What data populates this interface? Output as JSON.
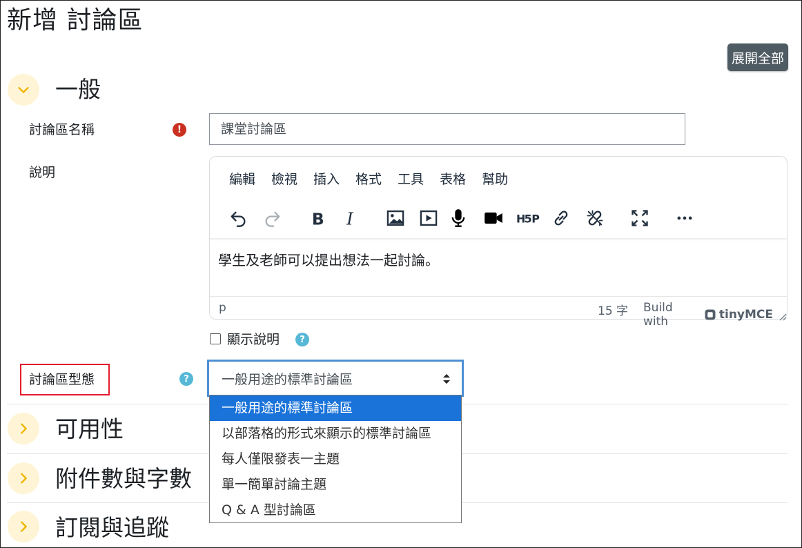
{
  "page_title": "新增 討論區",
  "expand_all_label": "展開全部",
  "sections": {
    "general": "一般",
    "availability": "可用性",
    "attachments": "附件數與字數",
    "subscription": "訂閱與追蹤"
  },
  "fields": {
    "name_label": "討論區名稱",
    "name_value": "課堂討論區",
    "description_label": "說明",
    "show_description_label": "顯示說明",
    "type_label": "討論區型態",
    "type_value": "一般用途的標準討論區"
  },
  "editor": {
    "menu": [
      "編輯",
      "檢視",
      "插入",
      "格式",
      "工具",
      "表格",
      "幫助"
    ],
    "toolbar_icons": [
      "undo-icon",
      "redo-icon",
      "bold-icon",
      "italic-icon",
      "image-icon",
      "media-icon",
      "microphone-icon",
      "video-camera-icon",
      "h5p-icon",
      "link-icon",
      "unlink-icon",
      "fullscreen-icon",
      "more-icon"
    ],
    "content": "學生及老師可以提出想法一起討論。",
    "status_path": "p",
    "word_count": "15 字",
    "build_with": "Build with",
    "brand": "tinyMCE"
  },
  "dropdown_options": [
    "一般用途的標準討論區",
    "以部落格的形式來顯示的標準討論區",
    "每人僅限發表一主題",
    "單一簡單討論主題",
    "Q & A 型討論區"
  ],
  "colors": {
    "primary_button": "#4f5b63",
    "selected_option": "#1a73d9",
    "required_icon": "#ca3120",
    "help_icon": "#56b8d6",
    "section_toggle_bg": "#fff5d6",
    "section_toggle_chevron": "#f0b400",
    "highlight_box": "#e11b2c",
    "select_focus": "#4e8fd3"
  }
}
